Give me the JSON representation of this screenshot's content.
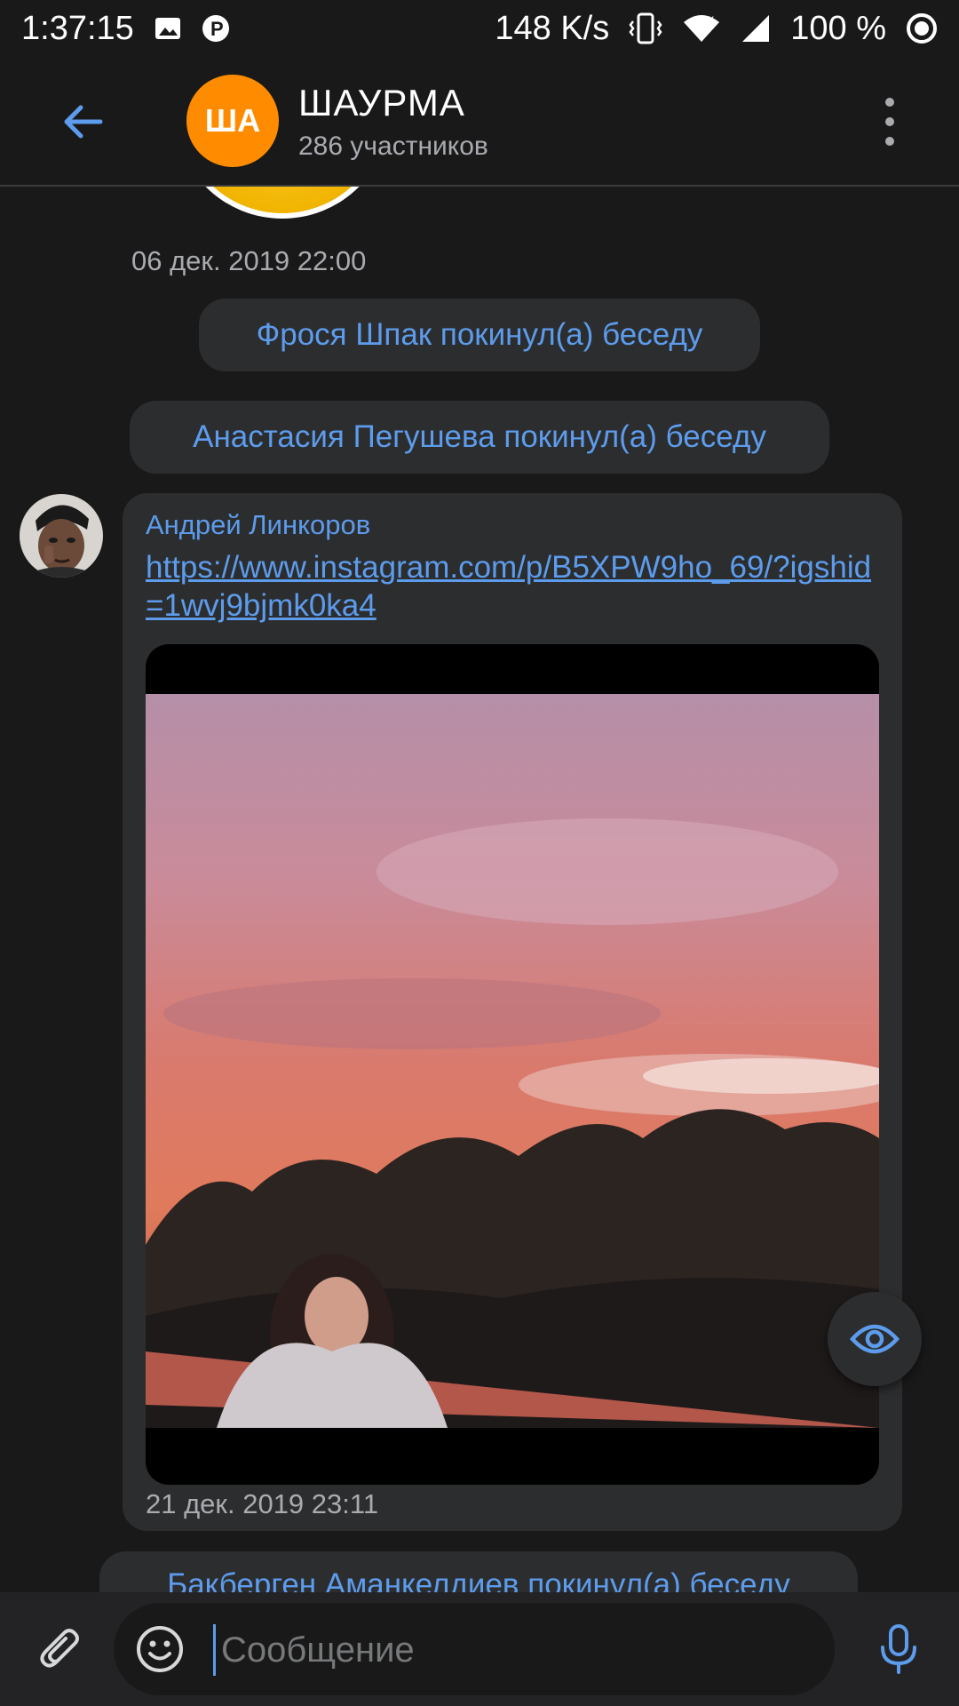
{
  "status_bar": {
    "time": "1:37:15",
    "net_speed": "148 K/s",
    "battery": "100 %",
    "icons": [
      "image-icon",
      "p-icon",
      "vibrate-icon",
      "wifi-icon",
      "signal-icon",
      "circle-status-icon"
    ]
  },
  "header": {
    "back_icon": "arrow-left-icon",
    "avatar_text": "ША",
    "avatar_color": "#ff8c00",
    "title": "ШАУРМА",
    "subtitle": "286 участников",
    "menu_icon": "more-vertical-icon"
  },
  "messages": {
    "date_1": "06 дек. 2019 22:00",
    "service_1": "Фрося Шпак покинул(а) беседу",
    "service_2": "Анастасия Пегушева покинул(а) беседу",
    "post": {
      "sender": "Андрей Линкоров",
      "link": "https://www.instagram.com/p/B5XPW9ho_69/?igshid=1wvj9bjmk0ka4",
      "time": "21 дек. 2019 23:11"
    },
    "service_3": "Бакберген Аманкелдиев покинул(а) беседу"
  },
  "input_bar": {
    "placeholder": "Сообщение",
    "attach_icon": "paperclip-icon",
    "emoji_icon": "smiley-icon",
    "mic_icon": "microphone-icon"
  },
  "fab": {
    "icon": "eye-icon"
  },
  "colors": {
    "accent": "#5d9cec",
    "background": "#19191a",
    "bubble": "#2c2d2f"
  }
}
